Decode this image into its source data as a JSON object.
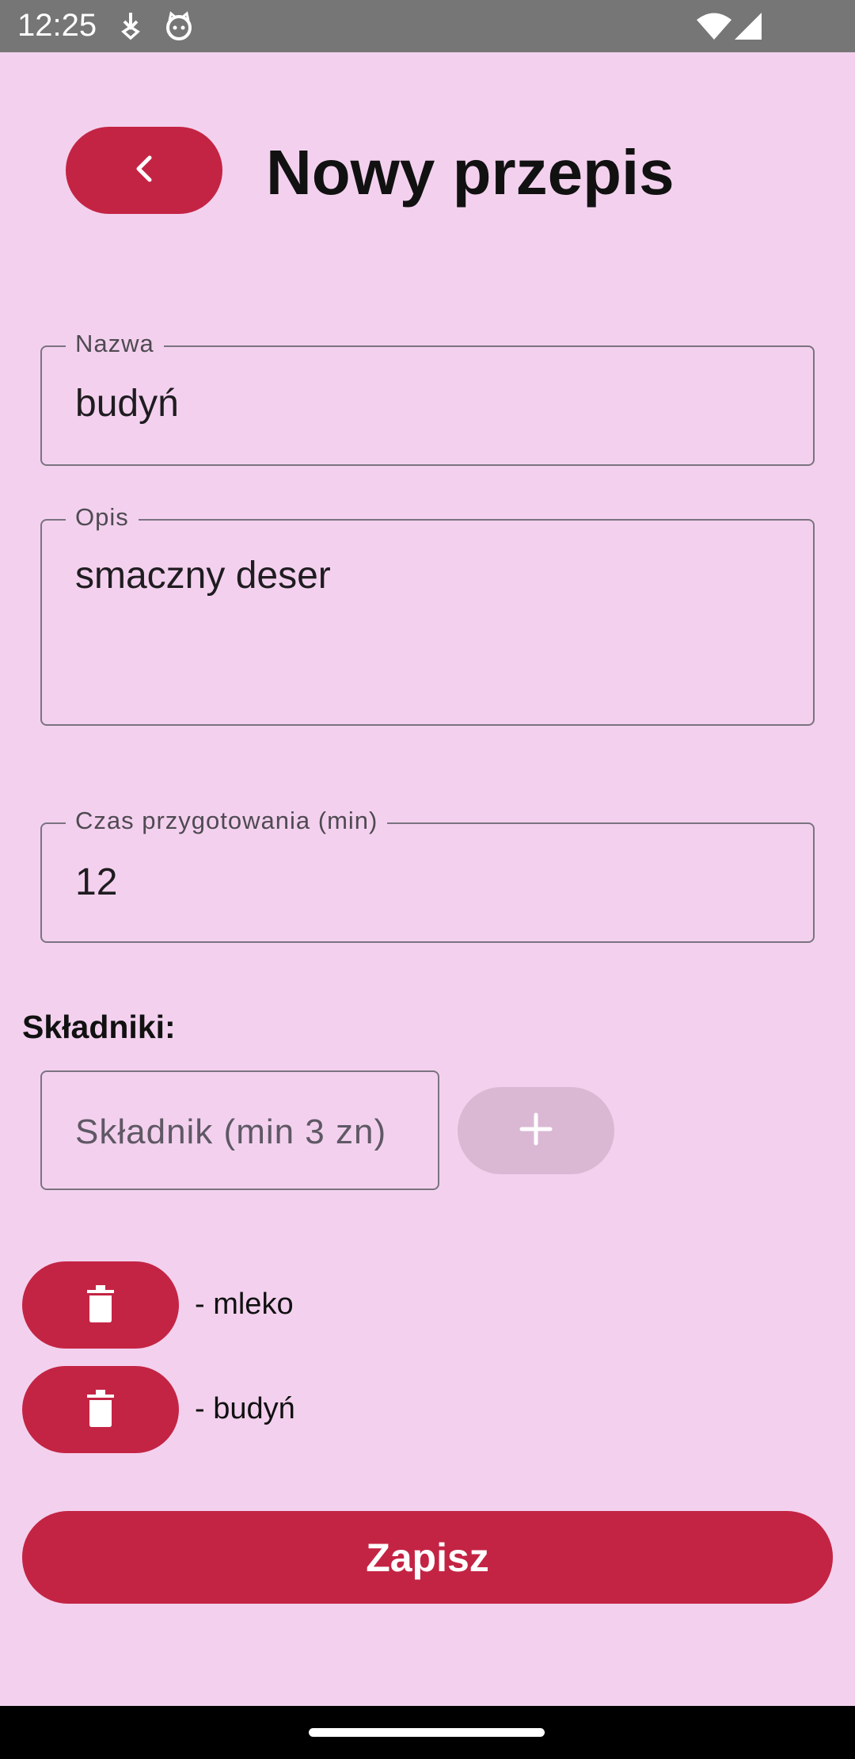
{
  "status_bar": {
    "time": "12:25"
  },
  "header": {
    "title": "Nowy przepis"
  },
  "form": {
    "name": {
      "label": "Nazwa",
      "value": "budyń"
    },
    "description": {
      "label": "Opis",
      "value": "smaczny deser"
    },
    "prep_time": {
      "label": "Czas przygotowania (min)",
      "value": "12"
    }
  },
  "ingredients": {
    "section_label": "Składniki:",
    "input_placeholder": "Składnik (min 3 zn)",
    "items": [
      {
        "text": "- mleko"
      },
      {
        "text": "- budyń"
      }
    ]
  },
  "actions": {
    "save_label": "Zapisz"
  },
  "colors": {
    "background": "#f3d1ee",
    "accent": "#c42444",
    "disabled": "#dab8d4"
  }
}
